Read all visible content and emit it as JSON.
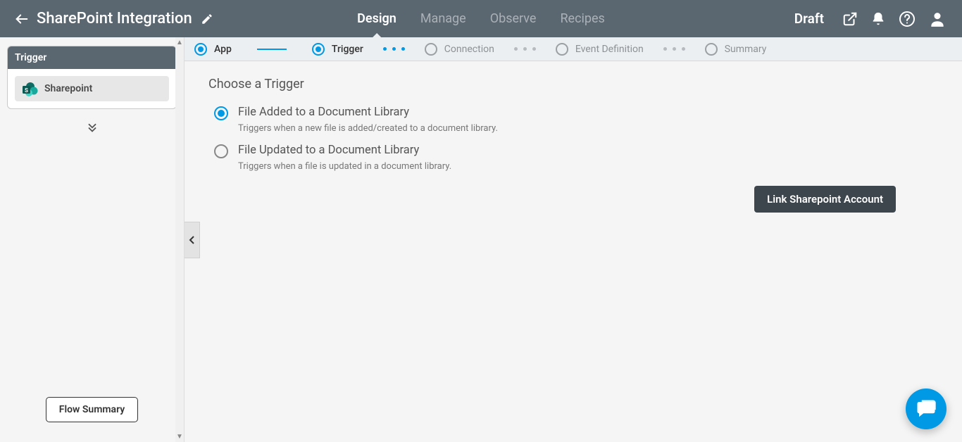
{
  "header": {
    "title": "SharePoint Integration",
    "tabs": [
      "Design",
      "Manage",
      "Observe",
      "Recipes"
    ],
    "activeTabIndex": 0,
    "status": "Draft"
  },
  "sidebar": {
    "panelTitle": "Trigger",
    "appItemLabel": "Sharepoint",
    "flowSummaryLabel": "Flow Summary"
  },
  "stepper": {
    "steps": [
      "App",
      "Trigger",
      "Connection",
      "Event Definition",
      "Summary"
    ],
    "activeIndices": [
      0,
      1
    ]
  },
  "content": {
    "sectionTitle": "Choose a Trigger",
    "options": [
      {
        "title": "File Added to a Document Library",
        "desc": "Triggers when a new file is added/created to a document library.",
        "selected": true
      },
      {
        "title": "File Updated to a Document Library",
        "desc": "Triggers when a file is updated in a document library.",
        "selected": false
      }
    ],
    "linkButtonLabel": "Link Sharepoint Account"
  },
  "colors": {
    "accent": "#0099e5",
    "headerBg": "#5a6670",
    "darkButton": "#3d464d"
  }
}
